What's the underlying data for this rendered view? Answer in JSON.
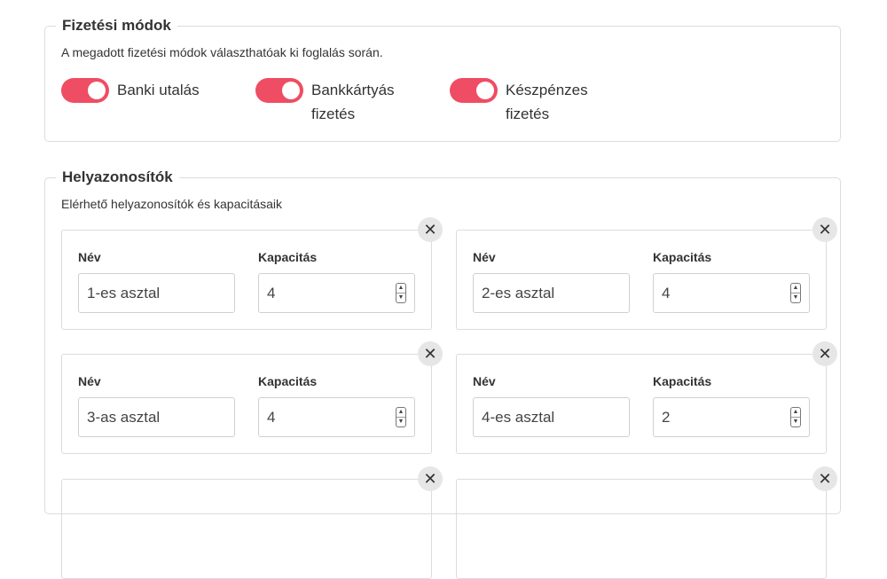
{
  "payment": {
    "title": "Fizetési módok",
    "description": "A megadott fizetési módok választhatóak ki foglalás során.",
    "options": [
      {
        "label": "Banki utalás",
        "enabled": true
      },
      {
        "label": "Bankkártyás fizetés",
        "enabled": true
      },
      {
        "label": "Készpénzes fizetés",
        "enabled": true
      }
    ],
    "toggle_color": "#ef4d63"
  },
  "places": {
    "title": "Helyazonosítók",
    "description": "Elérhető helyazonosítók és kapacitásaik",
    "name_label": "Név",
    "capacity_label": "Kapacitás",
    "close_symbol": "✕",
    "spin_up": "▲",
    "spin_down": "▼",
    "items": [
      {
        "name": "1-es asztal",
        "capacity": "4"
      },
      {
        "name": "2-es asztal",
        "capacity": "4"
      },
      {
        "name": "3-as asztal",
        "capacity": "4"
      },
      {
        "name": "4-es asztal",
        "capacity": "2"
      },
      {
        "name": "",
        "capacity": ""
      },
      {
        "name": "",
        "capacity": ""
      }
    ]
  }
}
